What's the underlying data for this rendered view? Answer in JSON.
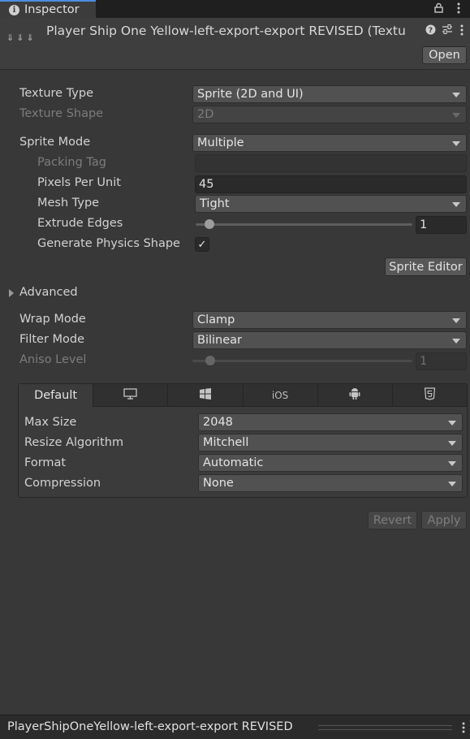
{
  "tab": {
    "title": "Inspector",
    "icon": "info-icon"
  },
  "tab_controls": {
    "lock": "lock-icon",
    "menu": "kebab-menu-icon"
  },
  "header": {
    "asset_title": "Player Ship One Yellow-left-export-export REVISED (Textu",
    "icons": [
      "help-icon",
      "presets-icon",
      "kebab-menu-icon"
    ],
    "open_label": "Open"
  },
  "importer": {
    "texture_type": {
      "label": "Texture Type",
      "value": "Sprite (2D and UI)"
    },
    "texture_shape": {
      "label": "Texture Shape",
      "value": "2D"
    },
    "sprite_mode": {
      "label": "Sprite Mode",
      "value": "Multiple"
    },
    "packing_tag": {
      "label": "Packing Tag",
      "value": ""
    },
    "pixels_per_unit": {
      "label": "Pixels Per Unit",
      "value": "45"
    },
    "mesh_type": {
      "label": "Mesh Type",
      "value": "Tight"
    },
    "extrude_edges": {
      "label": "Extrude Edges",
      "value": "1",
      "slider_fraction": 0.04
    },
    "generate_physics_shape": {
      "label": "Generate Physics Shape",
      "checked": true,
      "check_glyph": "✓"
    },
    "sprite_editor_label": "Sprite Editor",
    "advanced_label": "Advanced",
    "wrap_mode": {
      "label": "Wrap Mode",
      "value": "Clamp"
    },
    "filter_mode": {
      "label": "Filter Mode",
      "value": "Bilinear"
    },
    "aniso_level": {
      "label": "Aniso Level",
      "value": "1",
      "slider_fraction": 0.06
    }
  },
  "platforms": {
    "tabs": [
      {
        "label": "Default",
        "icon": ""
      },
      {
        "label": "",
        "icon": "monitor-icon"
      },
      {
        "label": "",
        "icon": "windows-icon"
      },
      {
        "label": "iOS",
        "icon": ""
      },
      {
        "label": "",
        "icon": "android-icon"
      },
      {
        "label": "",
        "icon": "html5-icon"
      }
    ],
    "max_size": {
      "label": "Max Size",
      "value": "2048"
    },
    "resize_algorithm": {
      "label": "Resize Algorithm",
      "value": "Mitchell"
    },
    "format": {
      "label": "Format",
      "value": "Automatic"
    },
    "compression": {
      "label": "Compression",
      "value": "None"
    }
  },
  "actions": {
    "revert_label": "Revert",
    "apply_label": "Apply"
  },
  "status_bar": {
    "text": "PlayerShipOneYellow-left-export-export REVISED"
  },
  "colors": {
    "accent": "#4a8ee0",
    "panel": "#383838",
    "dropdown": "#515151"
  }
}
